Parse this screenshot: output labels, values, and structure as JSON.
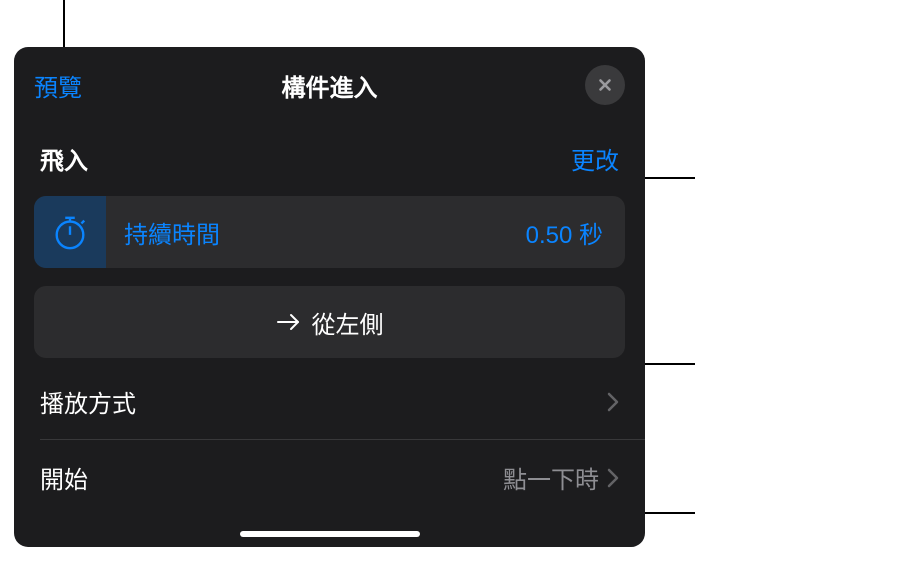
{
  "header": {
    "preview": "預覽",
    "title": "構件進入"
  },
  "effect": {
    "name": "飛入",
    "change": "更改"
  },
  "duration": {
    "label": "持續時間",
    "value": "0.50 秒"
  },
  "direction": {
    "label": "從左側"
  },
  "delivery": {
    "label": "播放方式"
  },
  "start": {
    "label": "開始",
    "value": "點一下時"
  }
}
